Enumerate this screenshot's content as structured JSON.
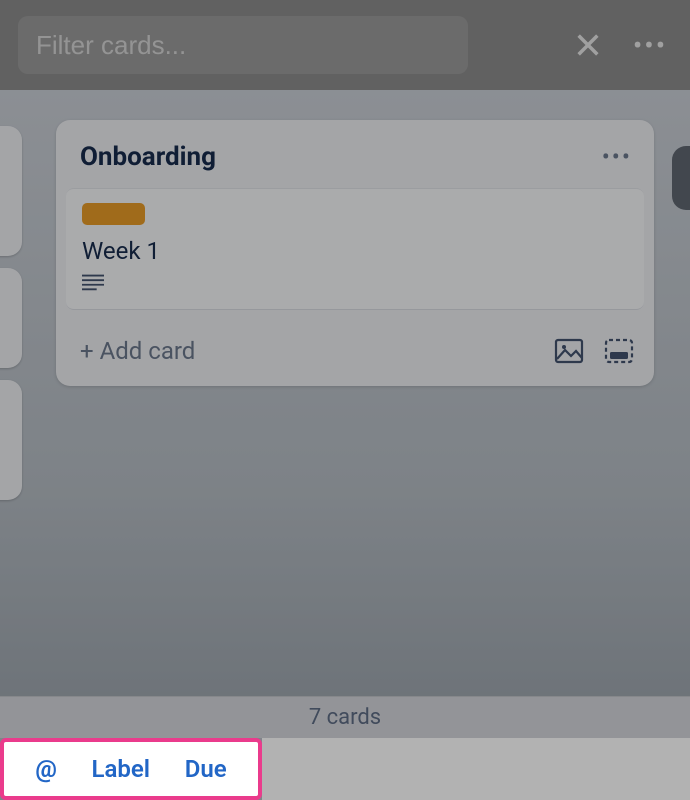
{
  "topbar": {
    "filter_placeholder": "Filter cards..."
  },
  "list": {
    "title": "Onboarding",
    "cards": [
      {
        "title": "Week 1",
        "label_color": "#e69a27",
        "has_description": true
      }
    ],
    "add_card_label": "+ Add card"
  },
  "status": {
    "card_count_text": "7 cards"
  },
  "toolbar": {
    "mention_label": "@",
    "label_label": "Label",
    "due_label": "Due"
  },
  "colors": {
    "highlight_border": "#ea3b8c",
    "link": "#2266c6"
  }
}
